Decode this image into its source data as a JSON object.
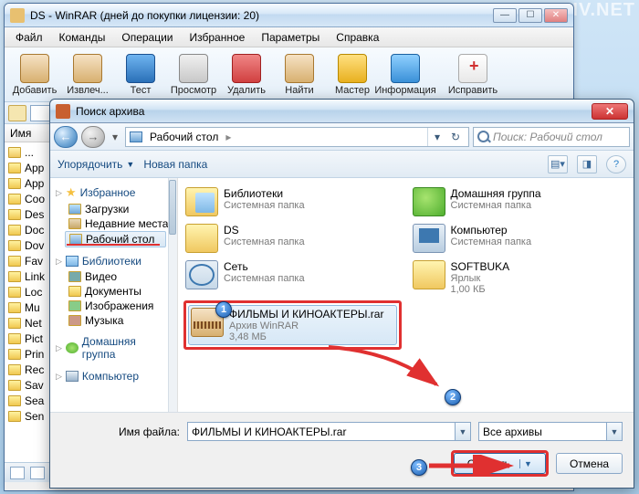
{
  "watermark": "MYDIV.NET",
  "main": {
    "title": "DS - WinRAR (дней до покупки лицензии: 20)",
    "menu": [
      "Файл",
      "Команды",
      "Операции",
      "Избранное",
      "Параметры",
      "Справка"
    ],
    "tools": [
      {
        "label": "Добавить"
      },
      {
        "label": "Извлеч..."
      },
      {
        "label": "Тест"
      },
      {
        "label": "Просмотр"
      },
      {
        "label": "Удалить"
      },
      {
        "label": "Найти"
      },
      {
        "label": "Мастер"
      },
      {
        "label": "Информация"
      },
      {
        "label": "Исправить"
      }
    ],
    "path": "",
    "col_name": "Имя",
    "files": [
      "...",
      "App",
      "App",
      "Coo",
      "Des",
      "Doc",
      "Dov",
      "Fav",
      "Link",
      "Loc",
      "Mu",
      "Net",
      "Pict",
      "Prin",
      "Rec",
      "Sav",
      "Sea",
      "Sen"
    ]
  },
  "dlg": {
    "title": "Поиск архива",
    "breadcrumb_icon": "desktop",
    "breadcrumb": "Рабочий стол",
    "search_placeholder": "Поиск: Рабочий стол",
    "organize": "Упорядочить",
    "newfolder": "Новая папка",
    "nav": {
      "fav": "Избранное",
      "fav_items": [
        "Загрузки",
        "Недавние места",
        "Рабочий стол"
      ],
      "libs": "Библиотеки",
      "lib_items": [
        "Видео",
        "Документы",
        "Изображения",
        "Музыка"
      ],
      "homegroup": "Домашняя группа",
      "computer": "Компьютер"
    },
    "items": [
      {
        "name": "Библиотеки",
        "sub": "Системная папка",
        "ic": "lib"
      },
      {
        "name": "Домашняя группа",
        "sub": "Системная папка",
        "ic": "home"
      },
      {
        "name": "DS",
        "sub": "Системная папка",
        "ic": "fold"
      },
      {
        "name": "Компьютер",
        "sub": "Системная папка",
        "ic": "comp"
      },
      {
        "name": "Сеть",
        "sub": "Системная папка",
        "ic": "net"
      },
      {
        "name": "SOFTBUKA",
        "sub": "Ярлык",
        "sub2": "1,00 КБ",
        "ic": "fold"
      },
      {
        "name": "ФИЛЬМЫ И КИНОАКТЕРЫ.rar",
        "sub": "Архив WinRAR",
        "sub2": "3,48 МБ",
        "ic": "rar",
        "selected": true
      }
    ],
    "filename_label": "Имя файла:",
    "filename_value": "ФИЛЬМЫ И КИНОАКТЕРЫ.rar",
    "filter": "Все архивы",
    "open": "Открыть",
    "cancel": "Отмена"
  },
  "callouts": [
    "1",
    "2",
    "3"
  ]
}
